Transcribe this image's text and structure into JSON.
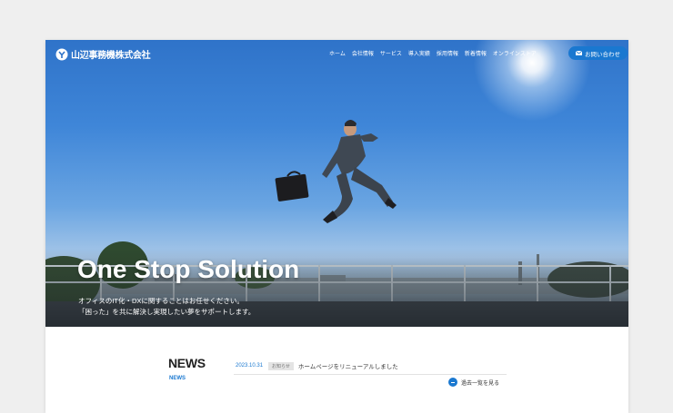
{
  "logo": {
    "text": "山辺事務機株式会社"
  },
  "nav": {
    "items": [
      "ホーム",
      "会社情報",
      "サービス",
      "導入実績",
      "採用情報",
      "新着情報",
      "オンラインストア"
    ],
    "contact_label": "お問い合わせ"
  },
  "hero": {
    "title": "One Stop Solution",
    "lines": [
      "オフィスのIT化・DXに関することはお任せください。",
      "「困った」を共に解決し実現したい夢をサポートします。"
    ]
  },
  "news": {
    "heading": "NEWS",
    "subheading": "NEWS",
    "items": [
      {
        "date": "2023.10.31",
        "badge": "お知らせ",
        "title": "ホームページをリニューアルしました"
      }
    ],
    "more_label": "過去一覧を見る"
  },
  "colors": {
    "accent": "#1a78d0",
    "page_bg": "#efefef"
  },
  "icons": {
    "logo": "logo-mark-icon",
    "mail": "mail-icon",
    "more": "arrow-circle-icon"
  }
}
